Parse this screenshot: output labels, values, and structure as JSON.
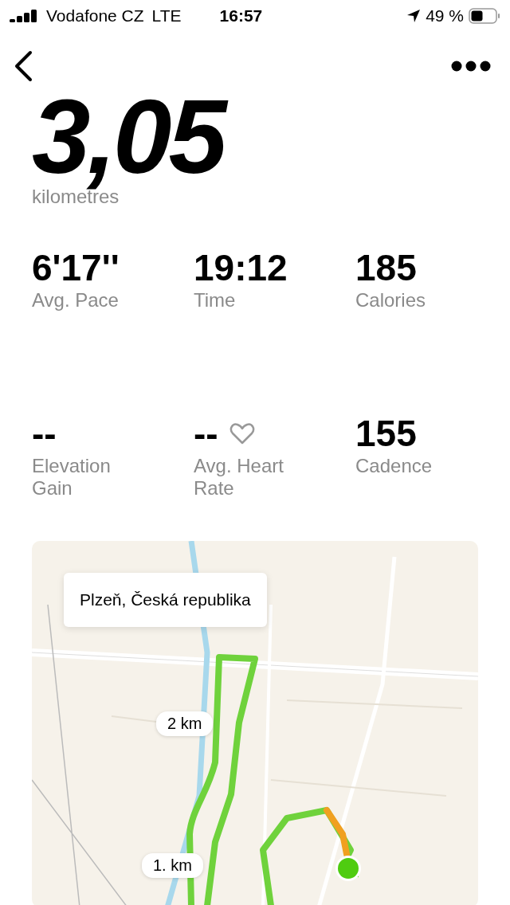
{
  "status_bar": {
    "carrier": "Vodafone CZ",
    "network": "LTE",
    "time": "16:57",
    "battery": "49 %"
  },
  "distance": {
    "value": "3,05",
    "unit": "kilometres"
  },
  "stats": [
    {
      "value": "6'17''",
      "label": "Avg. Pace",
      "kind": "plain"
    },
    {
      "value": "19:12",
      "label": "Time",
      "kind": "plain"
    },
    {
      "value": "185",
      "label": "Calories",
      "kind": "plain"
    },
    {
      "value": "--",
      "label": "Elevation Gain",
      "kind": "plain"
    },
    {
      "value": "--",
      "label": "Avg. Heart Rate",
      "kind": "heart"
    },
    {
      "value": "155",
      "label": "Cadence",
      "kind": "plain"
    }
  ],
  "map": {
    "kind": "picture",
    "location": "Plzeň, Česká republika",
    "markers": [
      "2 km",
      "1. km"
    ]
  }
}
